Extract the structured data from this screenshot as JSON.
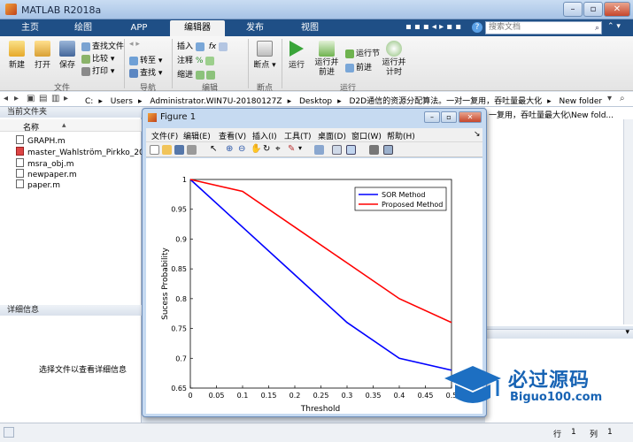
{
  "window": {
    "title": "MATLAB R2018a"
  },
  "tabs": [
    "主页",
    "绘图",
    "APP",
    "编辑器",
    "发布",
    "视图"
  ],
  "active_tab": "编辑器",
  "search": {
    "placeholder": "搜索文档"
  },
  "ribbon": {
    "file": {
      "new": "新建",
      "open": "打开",
      "save": "保存",
      "find_file": "查找文件",
      "compare": "比较",
      "print": "打印",
      "group": "文件"
    },
    "navigate": {
      "goto": "转至",
      "find": "查找",
      "group": "导航"
    },
    "edit": {
      "insert": "插入",
      "comment": "注释",
      "indent": "缩进",
      "group": "编辑"
    },
    "breakpoints": {
      "label": "断点",
      "group": "断点"
    },
    "run": {
      "run": "运行",
      "run_advance_1": "运行并",
      "run_advance_2": "前进",
      "run_section": "运行节",
      "advance": "前进",
      "run_time_1": "运行并",
      "run_time_2": "计时",
      "group": "运行"
    }
  },
  "address": {
    "path": [
      "C:",
      "Users",
      "Administrator.WIN7U-20180127Z",
      "Desktop",
      "D2D通信的资源分配算法。一对一复用，吞吐量最大化",
      "New folder"
    ],
    "separator": "▸"
  },
  "left_panel": {
    "title": "当前文件夹",
    "column": "名称",
    "files": [
      "GRAPH.m",
      "master_Wahlström_Pirkko_2015...",
      "msra_obj.m",
      "newpaper.m",
      "paper.m"
    ],
    "details_title": "详细信息",
    "details_hint": "选择文件以查看详细信息"
  },
  "right_panel": {
    "path_fragment": "一复用，吞吐量最大化\\New fold..."
  },
  "status": {
    "row_label": "行",
    "row": "1",
    "col_label": "列",
    "col": "1"
  },
  "figure": {
    "title": "Figure 1",
    "menu": [
      "文件(F)",
      "编辑(E)",
      "查看(V)",
      "插入(I)",
      "工具(T)",
      "桌面(D)",
      "窗口(W)",
      "帮助(H)"
    ]
  },
  "chart_data": {
    "type": "line",
    "title": "",
    "xlabel": "Threshold",
    "ylabel": "Sucess Probability",
    "xlim": [
      0,
      0.5
    ],
    "ylim": [
      0.65,
      1
    ],
    "xticks": [
      "0",
      "0.05",
      "0.1",
      "0.15",
      "0.2",
      "0.25",
      "0.3",
      "0.35",
      "0.4",
      "0.45",
      "0.5"
    ],
    "yticks": [
      "0.65",
      "0.7",
      "0.75",
      "0.8",
      "0.85",
      "0.9",
      "0.95",
      "1"
    ],
    "grid": false,
    "legend_position": "top-right",
    "series": [
      {
        "name": "SOR Method",
        "color": "#0000ff",
        "x": [
          0,
          0.1,
          0.2,
          0.3,
          0.4,
          0.5
        ],
        "y": [
          1.0,
          0.92,
          0.84,
          0.76,
          0.7,
          0.68
        ]
      },
      {
        "name": "Proposed Method",
        "color": "#ff0000",
        "x": [
          0,
          0.1,
          0.2,
          0.3,
          0.4,
          0.5
        ],
        "y": [
          1.0,
          0.98,
          0.92,
          0.86,
          0.8,
          0.76
        ]
      }
    ]
  },
  "watermark": {
    "text": "必过源码",
    "sub": "Biguo100.com"
  }
}
